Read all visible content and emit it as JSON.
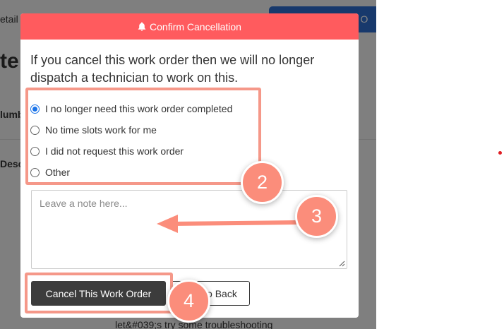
{
  "background": {
    "detail_fragment": "etail",
    "title_fragment": "te",
    "number_fragment": "lumb",
    "description_fragment": "Descr",
    "button_fragment": "rk O",
    "footer_fragment": "let&#039;s try some troubleshooting"
  },
  "modal": {
    "header_title": "Confirm Cancellation",
    "intro_text": "If you cancel this work order then we will no longer dispatch a technician to work on this.",
    "options": [
      {
        "label": "I no longer need this work order completed",
        "checked": true
      },
      {
        "label": "No time slots work for me",
        "checked": false
      },
      {
        "label": "I did not request this work order",
        "checked": false
      },
      {
        "label": "Other",
        "checked": false
      }
    ],
    "note_placeholder": "Leave a note here...",
    "note_value": "",
    "cancel_button_label": "Cancel This Work Order",
    "go_back_label": "Go Back"
  },
  "annotations": {
    "step_2": "2",
    "step_3": "3",
    "step_4": "4"
  },
  "colors": {
    "header_red": "#ff5b5e",
    "highlight_salmon": "#f59889",
    "badge_salmon": "#fb8d7b",
    "primary_dark": "#3c3c3c",
    "radio_blue": "#1a73e8"
  }
}
